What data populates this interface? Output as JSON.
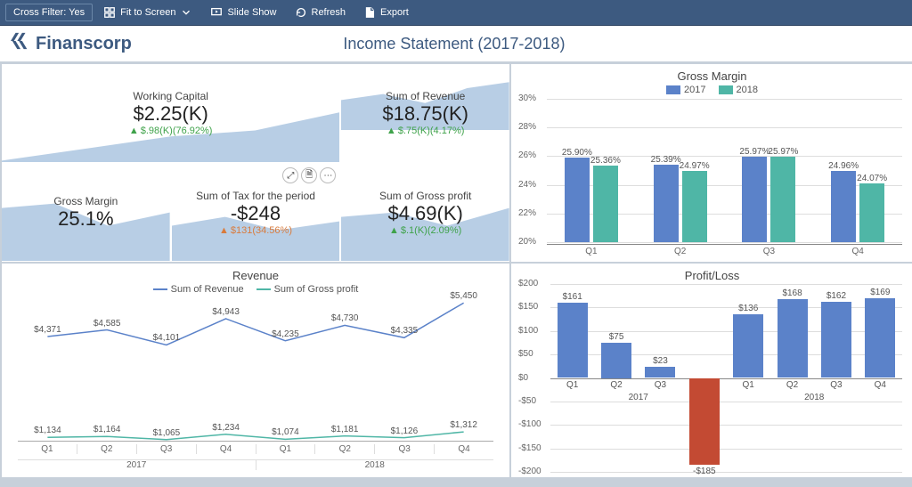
{
  "toolbar": {
    "cross_filter": "Cross Filter: Yes",
    "fit": "Fit to Screen",
    "slide": "Slide Show",
    "refresh": "Refresh",
    "export": "Export"
  },
  "brand": "Finanscorp",
  "page_title": "Income Statement (2017-2018)",
  "kpis": {
    "working_capital": {
      "title": "Working Capital",
      "value": "$2.25(K)",
      "delta": "$.98(K)(76.92%)",
      "dir": "up"
    },
    "sum_revenue": {
      "title": "Sum of Revenue",
      "value": "$18.75(K)",
      "delta": "$.75(K)(4.17%)",
      "dir": "up"
    },
    "gross_margin": {
      "title": "Gross Margin",
      "value": "25.1%"
    },
    "sum_tax": {
      "title": "Sum of Tax for the period",
      "value": "-$248",
      "delta": "$131(34.56%)",
      "dir": "down"
    },
    "sum_gross_profit": {
      "title": "Sum of Gross profit",
      "value": "$4.69(K)",
      "delta": "$.1(K)(2.09%)",
      "dir": "up"
    }
  },
  "chart_data": [
    {
      "id": "gross_margin",
      "type": "bar",
      "title": "Gross Margin",
      "categories": [
        "Q1",
        "Q2",
        "Q3",
        "Q4"
      ],
      "series": [
        {
          "name": "2017",
          "values": [
            25.9,
            25.39,
            25.97,
            24.96
          ],
          "color": "#5B82C9"
        },
        {
          "name": "2018",
          "values": [
            25.36,
            24.97,
            25.97,
            24.07
          ],
          "color": "#4FB6A6"
        }
      ],
      "ylim": [
        20,
        30
      ],
      "ytick": 2,
      "value_suffix": "%",
      "data_labels": [
        "25.90%",
        "25.36%",
        "25.39%",
        "24.97%",
        "25.97%",
        "25.97%",
        "24.96%",
        "24.07%"
      ]
    },
    {
      "id": "revenue",
      "type": "line",
      "title": "Revenue",
      "x": [
        [
          "Q1",
          "Q2",
          "Q3",
          "Q4",
          "Q1",
          "Q2",
          "Q3",
          "Q4"
        ],
        [
          "2017",
          "2017",
          "2017",
          "2017",
          "2018",
          "2018",
          "2018",
          "2018"
        ]
      ],
      "series": [
        {
          "name": "Sum of Revenue",
          "values": [
            4371,
            4585,
            4101,
            4943,
            4235,
            4730,
            4335,
            5450
          ],
          "color": "#5B82C9",
          "labels": [
            "$4,371",
            "$4,585",
            "$4,101",
            "$4,943",
            "$4,235",
            "$4,730",
            "$4,335",
            "$5,450"
          ]
        },
        {
          "name": "Sum of Gross profit",
          "values": [
            1134,
            1164,
            1065,
            1234,
            1074,
            1181,
            1126,
            1312
          ],
          "color": "#4FB6A6",
          "labels": [
            "$1,134",
            "$1,164",
            "$1,065",
            "$1,234",
            "$1,074",
            "$1,181",
            "$1,126",
            "$1,312"
          ]
        }
      ],
      "ylim": [
        1000,
        5600
      ]
    },
    {
      "id": "profit_loss",
      "type": "bar",
      "title": "Profit/Loss",
      "x": [
        [
          "Q1",
          "Q2",
          "Q3",
          "Q4",
          "Q1",
          "Q2",
          "Q3",
          "Q4"
        ],
        [
          "2017",
          "2017",
          "2017",
          "2017",
          "2018",
          "2018",
          "2018",
          "2018"
        ]
      ],
      "values": [
        161,
        75,
        23,
        -185,
        136,
        168,
        162,
        169
      ],
      "labels": [
        "$161",
        "$75",
        "$23",
        "-$185",
        "$136",
        "$168",
        "$162",
        "$169"
      ],
      "colors": [
        "#5B82C9",
        "#5B82C9",
        "#5B82C9",
        "#C34A33",
        "#5B82C9",
        "#5B82C9",
        "#5B82C9",
        "#5B82C9"
      ],
      "ylim": [
        -200,
        200
      ],
      "ytick": 50,
      "ylabel_prefix": "$"
    }
  ]
}
